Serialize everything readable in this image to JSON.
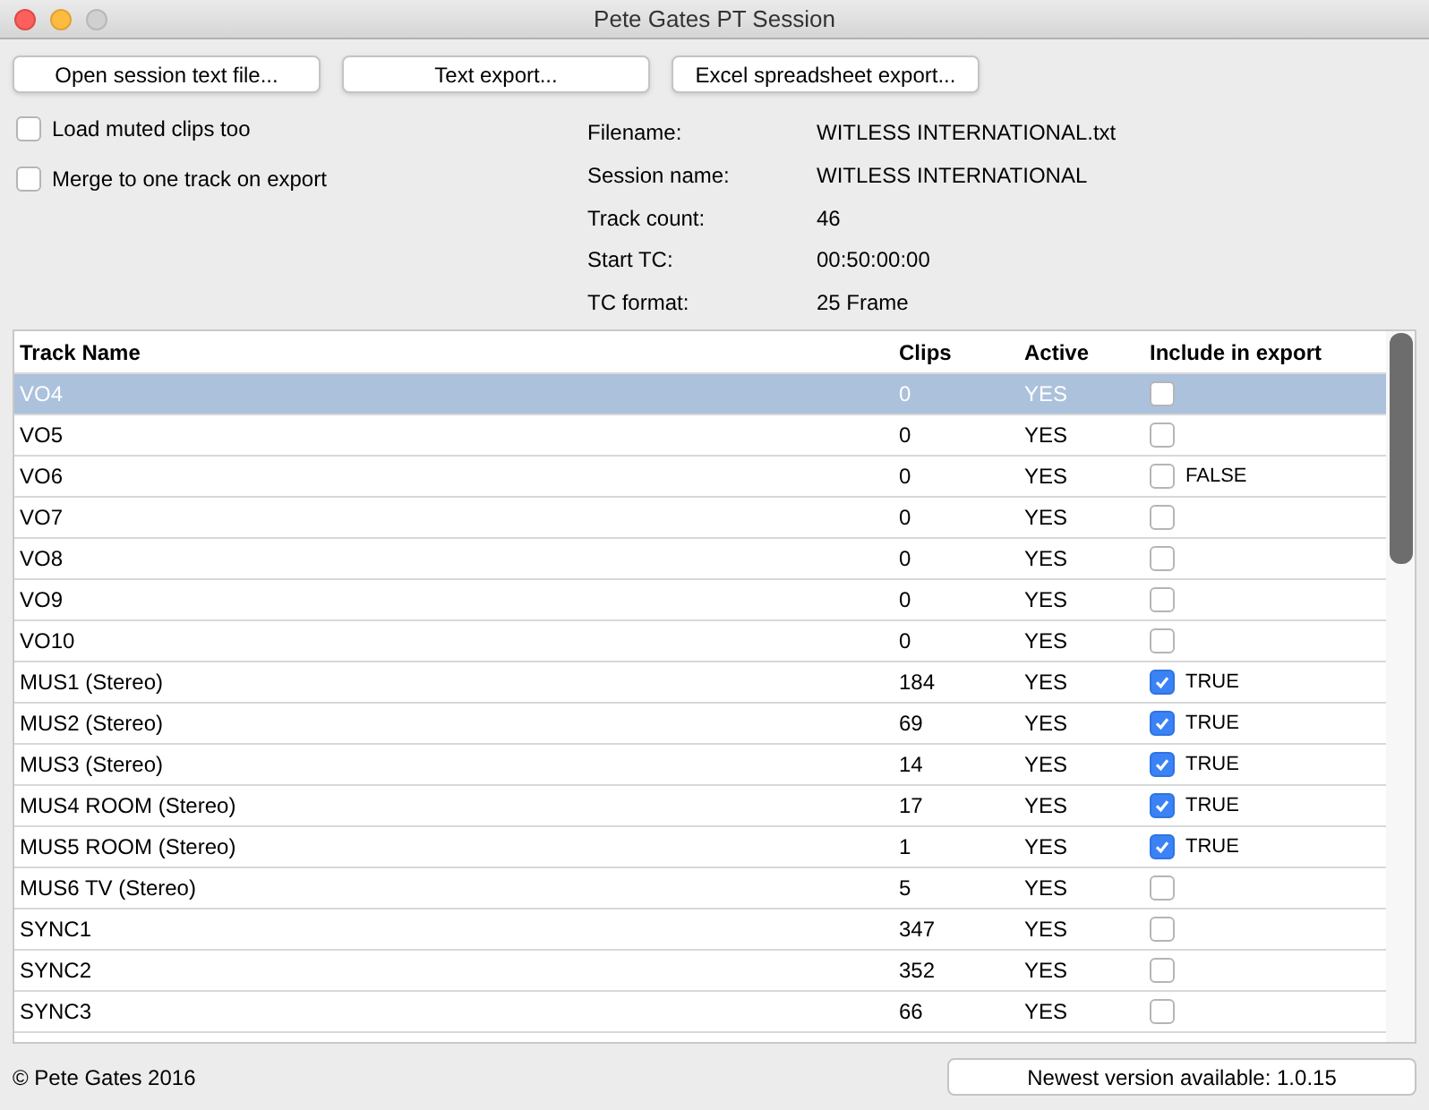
{
  "window": {
    "title": "Pete Gates PT Session"
  },
  "buttons": [
    "Open session text file...",
    "Text export...",
    "Excel spreadsheet export..."
  ],
  "options": [
    {
      "label": "Load muted clips too",
      "checked": false
    },
    {
      "label": "Merge to one track on export",
      "checked": false
    }
  ],
  "info": [
    {
      "label": "Filename:",
      "value": "WITLESS INTERNATIONAL.txt"
    },
    {
      "label": "Session name:",
      "value": "WITLESS INTERNATIONAL"
    },
    {
      "label": "Track count:",
      "value": "46"
    },
    {
      "label": "Start TC:",
      "value": "00:50:00:00"
    },
    {
      "label": "TC format:",
      "value": "25 Frame"
    }
  ],
  "table": {
    "columns": [
      "Track Name",
      "Clips",
      "Active",
      "Include in export"
    ],
    "rows": [
      {
        "name": "VO4",
        "clips": "0",
        "active": "YES",
        "checked": false,
        "selected": true
      },
      {
        "name": "VO5",
        "clips": "0",
        "active": "YES",
        "checked": false,
        "selected": false
      },
      {
        "name": "VO6",
        "clips": "0",
        "active": "YES",
        "checked": false,
        "value": "FALSE",
        "selected": false
      },
      {
        "name": "VO7",
        "clips": "0",
        "active": "YES",
        "checked": false,
        "selected": false
      },
      {
        "name": "VO8",
        "clips": "0",
        "active": "YES",
        "checked": false,
        "selected": false
      },
      {
        "name": "VO9",
        "clips": "0",
        "active": "YES",
        "checked": false,
        "selected": false
      },
      {
        "name": "VO10",
        "clips": "0",
        "active": "YES",
        "checked": false,
        "selected": false
      },
      {
        "name": "MUS1 (Stereo)",
        "clips": "184",
        "active": "YES",
        "checked": true,
        "value": "TRUE",
        "selected": false
      },
      {
        "name": "MUS2 (Stereo)",
        "clips": "69",
        "active": "YES",
        "checked": true,
        "value": "TRUE",
        "selected": false
      },
      {
        "name": "MUS3 (Stereo)",
        "clips": "14",
        "active": "YES",
        "checked": true,
        "value": "TRUE",
        "selected": false
      },
      {
        "name": "MUS4 ROOM (Stereo)",
        "clips": "17",
        "active": "YES",
        "checked": true,
        "value": "TRUE",
        "selected": false
      },
      {
        "name": "MUS5 ROOM (Stereo)",
        "clips": "1",
        "active": "YES",
        "checked": true,
        "value": "TRUE",
        "selected": false
      },
      {
        "name": "MUS6 TV (Stereo)",
        "clips": "5",
        "active": "YES",
        "checked": false,
        "selected": false
      },
      {
        "name": "SYNC1",
        "clips": "347",
        "active": "YES",
        "checked": false,
        "selected": false
      },
      {
        "name": "SYNC2",
        "clips": "352",
        "active": "YES",
        "checked": false,
        "selected": false
      },
      {
        "name": "SYNC3",
        "clips": "66",
        "active": "YES",
        "checked": false,
        "selected": false
      }
    ]
  },
  "footer": {
    "copyright": "© Pete Gates 2016",
    "version_button": "Newest version available: 1.0.15"
  }
}
